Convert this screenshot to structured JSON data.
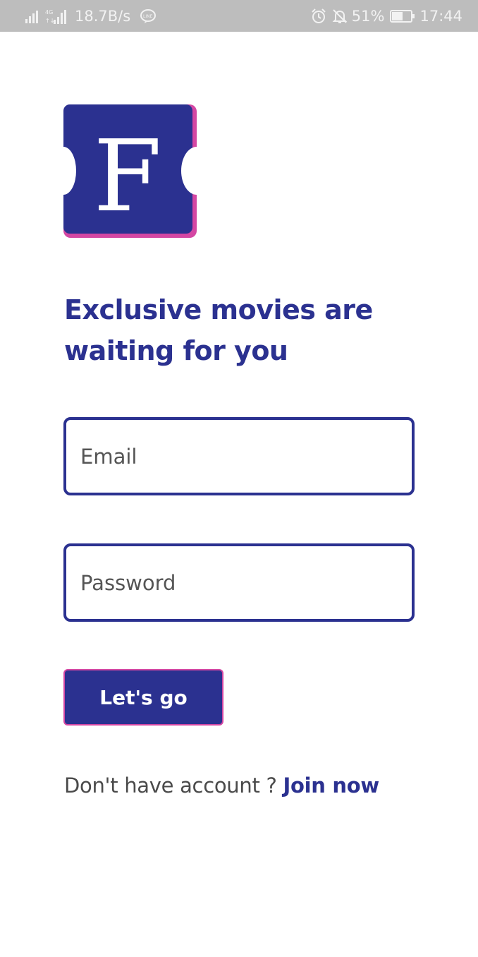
{
  "status_bar": {
    "network_speed": "18.7B/s",
    "battery_percent": "51%",
    "time": "17:44",
    "icons": [
      "signal-icon",
      "4g-signal-icon",
      "line-app-icon",
      "alarm-icon",
      "notifications-off-icon",
      "battery-icon"
    ]
  },
  "logo": {
    "letter": "F",
    "primary_color": "#2b3190",
    "accent_color": "#d447a3"
  },
  "headline": "Exclusive movies are waiting for you",
  "form": {
    "email_placeholder": "Email",
    "password_placeholder": "Password",
    "submit_label": "Let's go"
  },
  "signup": {
    "prompt": "Don't have account ? ",
    "link_label": "Join now"
  }
}
